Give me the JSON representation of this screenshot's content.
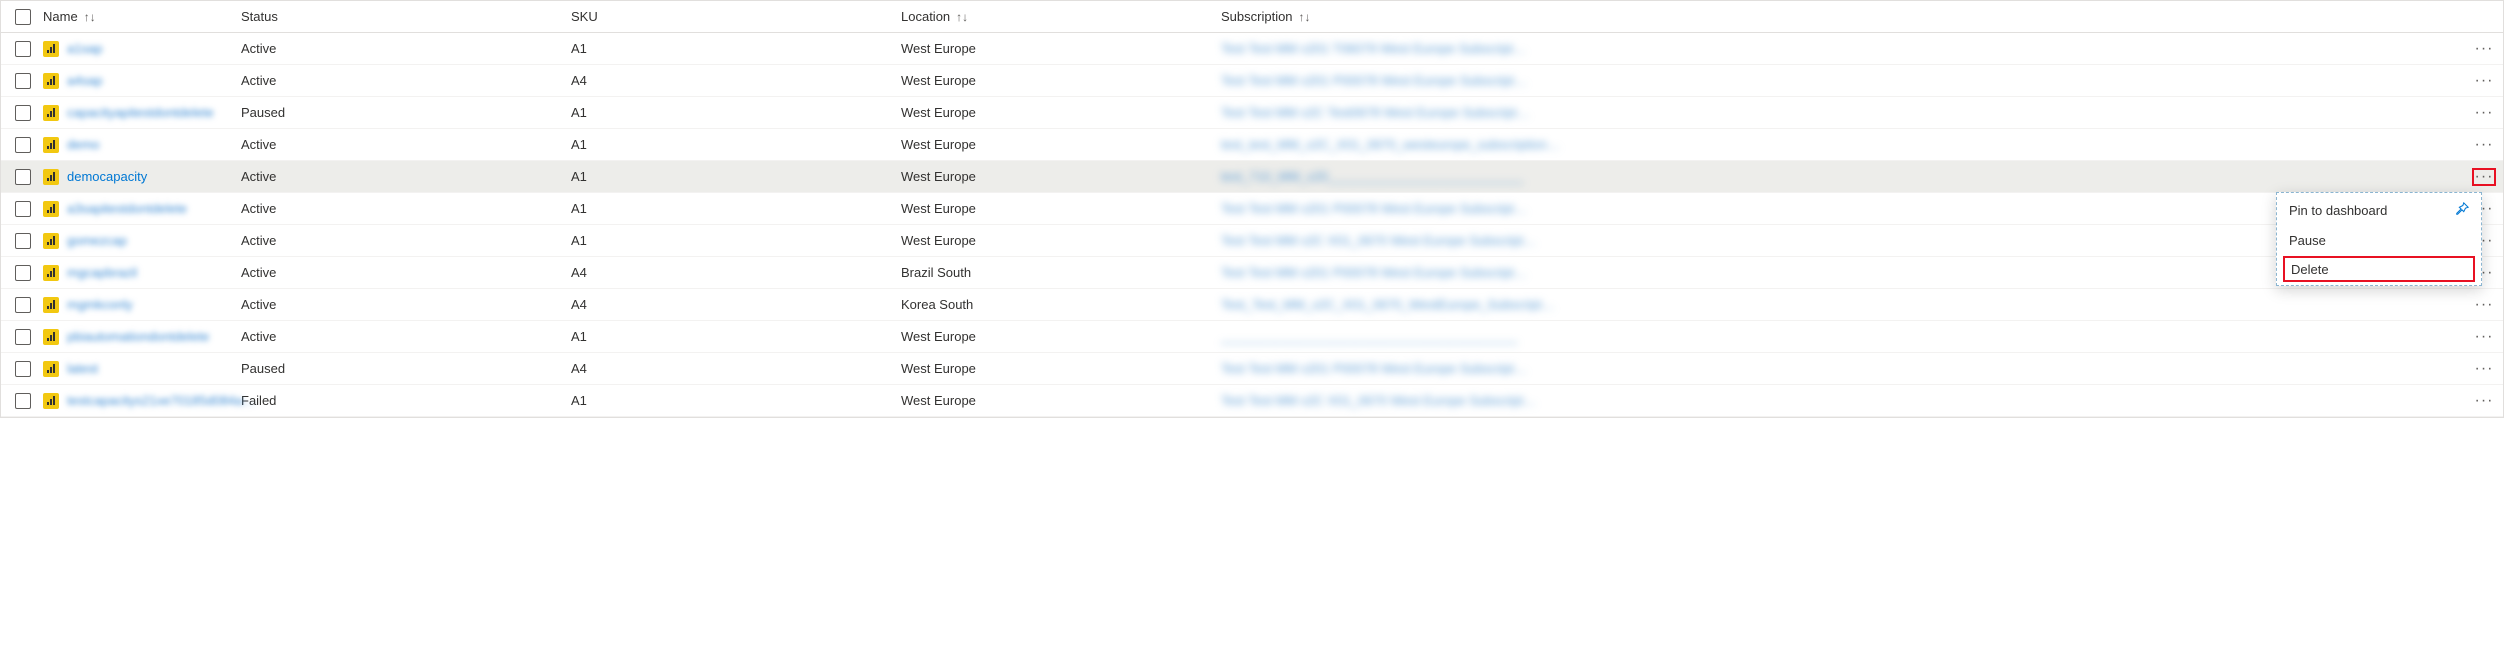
{
  "columns": {
    "name": "Name",
    "status": "Status",
    "sku": "SKU",
    "location": "Location",
    "subscription": "Subscription",
    "sort_symbol": "↑↓"
  },
  "rows": [
    {
      "name": "a1sap",
      "status": "Active",
      "sku": "A1",
      "location": "West Europe",
      "subscription": "Test Test MM x201 T06079 West Europe Subscript…",
      "blurred": true,
      "highlighted": false
    },
    {
      "name": "a4sap",
      "status": "Active",
      "sku": "A4",
      "location": "West Europe",
      "subscription": "Test Test MM x201 P00078 West Europe Subscript…",
      "blurred": true,
      "highlighted": false
    },
    {
      "name": "capacityapitestdontdelete",
      "status": "Paused",
      "sku": "A1",
      "location": "West Europe",
      "subscription": "Test Test MM x2C Test0678 West Europe Subscript…",
      "blurred": true,
      "highlighted": false
    },
    {
      "name": "demo",
      "status": "Active",
      "sku": "A1",
      "location": "West Europe",
      "subscription": "test_test_MM_x2C_X01_0670_westeurope_subscription…",
      "blurred": true,
      "highlighted": false
    },
    {
      "name": "democapacity",
      "status": "Active",
      "sku": "A1",
      "location": "West Europe",
      "subscription": "test_710_MM_x20___________________________",
      "blurred": false,
      "highlighted": true
    },
    {
      "name": "a3sapitestdontdelete",
      "status": "Active",
      "sku": "A1",
      "location": "West Europe",
      "subscription": "Test Test MM x201 P00078 West Europe Subscript…",
      "blurred": true,
      "highlighted": false
    },
    {
      "name": "gomezcap",
      "status": "Active",
      "sku": "A1",
      "location": "West Europe",
      "subscription": "Test Test MM x2C X01_0670 West Europe Subscript…",
      "blurred": true,
      "highlighted": false
    },
    {
      "name": "mgcapbrazil",
      "status": "Active",
      "sku": "A4",
      "location": "Brazil South",
      "subscription": "Test Test MM x201 P00078 West Europe Subscript…",
      "blurred": true,
      "highlighted": false
    },
    {
      "name": "mgmkconly",
      "status": "Active",
      "sku": "A4",
      "location": "Korea South",
      "subscription": "Test_Test_MM_x2C_X01_0670_WestEurope_Subscript…",
      "blurred": true,
      "highlighted": false
    },
    {
      "name": "pbiautomationdontdelete",
      "status": "Active",
      "sku": "A1",
      "location": "West Europe",
      "subscription": "_________________________________________",
      "blurred": true,
      "highlighted": false
    },
    {
      "name": "latest",
      "status": "Paused",
      "sku": "A4",
      "location": "West Europe",
      "subscription": "Test Test MM x201 P00078 West Europe Subscript…",
      "blurred": true,
      "highlighted": false
    },
    {
      "name": "testcapacitys21xe70185d084a…",
      "status": "Failed",
      "sku": "A1",
      "location": "West Europe",
      "subscription": "Test Test MM x2C X01_0670 West Europe Subscript…",
      "blurred": true,
      "highlighted": false
    }
  ],
  "context_menu": {
    "pin": "Pin to dashboard",
    "pause": "Pause",
    "delete": "Delete"
  }
}
